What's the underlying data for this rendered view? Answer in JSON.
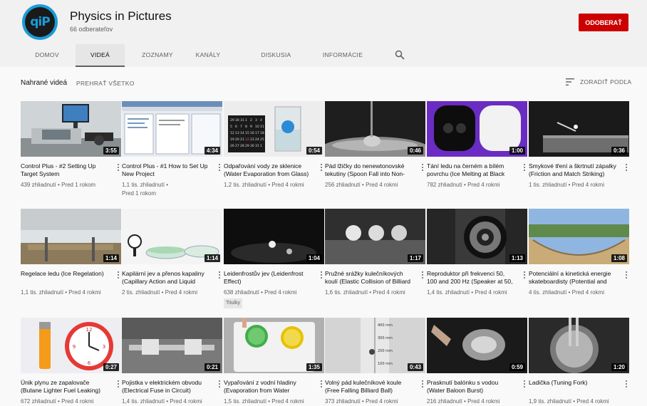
{
  "channel": {
    "name": "Physics in Pictures",
    "subscribers": "66 odberateľov",
    "logo_text": "qiP",
    "subscribe_label": "ODOBERAŤ"
  },
  "tabs": [
    "DOMOV",
    "VIDEÁ",
    "ZOZNAMY",
    "KANÁLY",
    "DISKUSIA",
    "INFORMÁCIE"
  ],
  "active_tab": "VIDEÁ",
  "subbar": {
    "title": "Nahrané videá",
    "play_all": "PREHRAŤ VŠETKO",
    "sort": "ZORADIŤ PODĽA"
  },
  "videos": [
    {
      "title": "Control Plus - #2 Setting Up Target System",
      "views": "439 zhliadnutí",
      "age": "Pred 1 rokom",
      "duration": "3:55"
    },
    {
      "title": "Control Plus - #1 How to Set Up New Project",
      "views": "1,1 tis. zhliadnutí",
      "age": "Pred 1 rokom",
      "duration": "4:34"
    },
    {
      "title": "Odpařování vody ze sklenice (Water Evaporation from Glass)",
      "views": "1,2 tis. zhliadnutí",
      "age": "Pred 4 rokmi",
      "duration": "0:54"
    },
    {
      "title": "Pád lžičky do nenewtonovské tekutiny (Spoon Fall into Non-Newtonian Fluid)",
      "views": "256 zhliadnutí",
      "age": "Pred 4 rokmi",
      "duration": "0:46"
    },
    {
      "title": "Tání ledu na černém a bílém povrchu (Ice Melting at Black and White Surface)",
      "views": "782 zhliadnutí",
      "age": "Pred 4 rokmi",
      "duration": "1:00"
    },
    {
      "title": "Smykové tření a škrtnutí zápalky (Friction and Match Striking)",
      "views": "1 tis. zhliadnutí",
      "age": "Pred 4 rokmi",
      "duration": "0:36"
    },
    {
      "title": "Regelace ledu (Ice Regelation)",
      "views": "1,1 tis. zhliadnutí",
      "age": "Pred 4 rokmi",
      "duration": "1:14"
    },
    {
      "title": "Kapilární jev a přenos kapaliny (Capillary Action and Liquid Transfer)",
      "views": "2 tis. zhliadnutí",
      "age": "Pred 4 rokmi",
      "duration": "1:14"
    },
    {
      "title": "Leidenfrostův jev (Leidenfrost Effect)",
      "views": "638 zhliadnutí",
      "age": "Pred 4 rokmi",
      "duration": "1:04",
      "badge": "Titulky"
    },
    {
      "title": "Pružné srážky kulečníkových koulí (Elastic Collision of Billiard Balls)",
      "views": "1,6 tis. zhliadnutí",
      "age": "Pred 4 rokmi",
      "duration": "1:17"
    },
    {
      "title": "Reproduktor při frekvenci 50, 100 and 200 Hz (Speaker at 50, 100 and 200 Hz)",
      "views": "1,4 tis. zhliadnutí",
      "age": "Pred 4 rokmi",
      "duration": "1:13"
    },
    {
      "title": "Potenciální a kinetická energie skateboardisty (Potential and Kinetic Energy)",
      "views": "4 tis. zhliadnutí",
      "age": "Pred 4 rokmi",
      "duration": "1:08"
    },
    {
      "title": "Únik plynu ze zapalovače (Butane Lighter Fuel Leaking)",
      "views": "672 zhliadnutí",
      "age": "Pred 4 rokmi",
      "duration": "0:27"
    },
    {
      "title": "Pojistka v elektrickém obvodu (Electrical Fuse in Circuit)",
      "views": "1,4 tis. zhliadnutí",
      "age": "Pred 4 rokmi",
      "duration": "0:21"
    },
    {
      "title": "Vypařování z vodní hladiny (Evaporation from Water Surface)",
      "views": "1,5 tis. zhliadnutí",
      "age": "Pred 4 rokmi",
      "duration": "1:35"
    },
    {
      "title": "Volný pád kulečníkové koule (Free Falling Billiard Ball)",
      "views": "373 zhliadnutí",
      "age": "Pred 4 rokmi",
      "duration": "0:43"
    },
    {
      "title": "Prasknutí balónku s vodou (Water Baloon Burst)",
      "views": "216 zhliadnutí",
      "age": "Pred 4 rokmi",
      "duration": "0:59"
    },
    {
      "title": "Ladička (Tuning Fork)",
      "views": "1,9 tis. zhliadnutí",
      "age": "Pred 4 rokmi",
      "duration": "1:20"
    }
  ],
  "thumb_text": {
    "calendar": [
      "29",
      "30",
      "31",
      "1",
      "2",
      "3",
      "4",
      "5",
      "6",
      "7",
      "8",
      "9",
      "10",
      "11",
      "12",
      "13",
      "14",
      "15",
      "16",
      "17",
      "18",
      "19",
      "20",
      "21",
      "22",
      "23",
      "24",
      "25",
      "26",
      "27",
      "28",
      "29",
      "30",
      "31",
      "1"
    ],
    "ruler": [
      "400 mm",
      "300 mm",
      "200 mm",
      "100 mm"
    ],
    "clock_numbers": [
      "12",
      "3",
      "6",
      "9"
    ]
  },
  "colors": {
    "accent": "#cc0000",
    "logo": "#1a9cd8"
  }
}
